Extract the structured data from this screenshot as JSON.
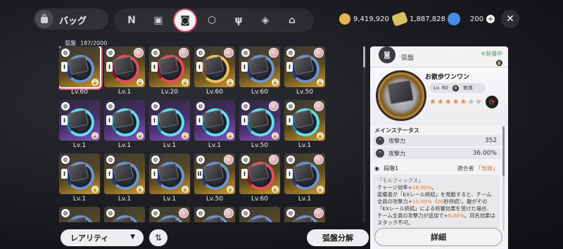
{
  "header": {
    "title": "バッグ",
    "tabs": [
      {
        "icon": "n-mark-icon",
        "glyph": "N"
      },
      {
        "icon": "device-icon",
        "glyph": "▣"
      },
      {
        "icon": "disc-icon",
        "glyph": "◙",
        "active": true
      },
      {
        "icon": "cube-icon",
        "glyph": "⬡"
      },
      {
        "icon": "utensils-icon",
        "glyph": "ψ"
      },
      {
        "icon": "gift-box-icon",
        "glyph": "◈"
      },
      {
        "icon": "home-icon",
        "glyph": "⌂"
      }
    ],
    "currencies": [
      {
        "icon": "coin-icon",
        "color": "#e8b64a",
        "value": "9,419,920"
      },
      {
        "icon": "ticket-icon",
        "color": "#d8c060",
        "value": "1,887,828"
      },
      {
        "icon": "crystal-icon",
        "color": "#4a8ae8",
        "value": "200"
      }
    ],
    "add_glyph": "+",
    "close_glyph": "✕"
  },
  "inventory": {
    "category": "弧盤",
    "count": "187/2000",
    "items": [
      {
        "lv": "Lv.60",
        "color": "gold",
        "disc": "blue",
        "avatar": false,
        "rank": "I",
        "selected": true
      },
      {
        "lv": "Lv.1",
        "color": "gold",
        "disc": "red",
        "avatar": true,
        "rank": "I"
      },
      {
        "lv": "Lv.20",
        "color": "gold",
        "disc": "red",
        "avatar": true,
        "rank": "I"
      },
      {
        "lv": "Lv.60",
        "color": "gold",
        "disc": "gold",
        "avatar": true,
        "rank": "I"
      },
      {
        "lv": "Lv.60",
        "color": "gold",
        "disc": "blue",
        "avatar": true,
        "rank": "I"
      },
      {
        "lv": "Lv.50",
        "color": "gold",
        "disc": "blue",
        "avatar": true,
        "rank": "I"
      },
      {
        "lv": "Lv.1",
        "color": "purple",
        "disc": "cyan",
        "avatar": false,
        "rank": "I"
      },
      {
        "lv": "Lv.1",
        "color": "purple",
        "disc": "cyan",
        "avatar": false,
        "rank": "I"
      },
      {
        "lv": "Lv.1",
        "color": "purple",
        "disc": "cyan",
        "avatar": false,
        "rank": "I"
      },
      {
        "lv": "Lv.1",
        "color": "purple",
        "disc": "cyan",
        "avatar": false,
        "rank": "I"
      },
      {
        "lv": "Lv.50",
        "color": "purple",
        "disc": "cyan",
        "avatar": true,
        "rank": "I"
      },
      {
        "lv": "Lv.1",
        "color": "gold",
        "disc": "cyan",
        "avatar": true,
        "rank": "I"
      },
      {
        "lv": "Lv.1",
        "color": "gold",
        "disc": "blue",
        "avatar": false,
        "rank": "I"
      },
      {
        "lv": "Lv.1",
        "color": "gold",
        "disc": "blue",
        "avatar": false,
        "rank": "I"
      },
      {
        "lv": "Lv.1",
        "color": "gold",
        "disc": "blue",
        "avatar": false,
        "rank": "I"
      },
      {
        "lv": "Lv.50",
        "color": "gold",
        "disc": "blue",
        "avatar": true,
        "rank": "II"
      },
      {
        "lv": "Lv.60",
        "color": "gold",
        "disc": "red",
        "avatar": true,
        "rank": "I"
      },
      {
        "lv": "Lv.1",
        "color": "gold",
        "disc": "blue",
        "avatar": true,
        "rank": "I"
      },
      {
        "lv": "",
        "color": "gold",
        "disc": "blue",
        "avatar": false,
        "rank": "I"
      },
      {
        "lv": "",
        "color": "gold",
        "disc": "blue",
        "avatar": false,
        "rank": "I"
      },
      {
        "lv": "",
        "color": "gold",
        "disc": "blue",
        "avatar": true,
        "rank": "I"
      },
      {
        "lv": "",
        "color": "gold",
        "disc": "blue",
        "avatar": true,
        "rank": "I"
      },
      {
        "lv": "",
        "color": "gold",
        "disc": "blue",
        "avatar": false,
        "rank": "I"
      },
      {
        "lv": "",
        "color": "gold",
        "disc": "blue",
        "avatar": true,
        "rank": "I"
      }
    ]
  },
  "controls": {
    "sort_label": "レアリティ",
    "sort_caret": "▼",
    "order_glyph": "⇅",
    "dismantle_label": "弧盤分解"
  },
  "detail": {
    "category": "弧盤",
    "equipped": "※装備中",
    "name": "お散歩ワンワン",
    "level": "Lv. 60",
    "element": "気体",
    "stars_on": "★★★★★",
    "stars_off": "★★",
    "badge_glyph": "⟳",
    "main_stats_title": "メインステータス",
    "stats": [
      {
        "label": "攻撃力",
        "value": "352"
      },
      {
        "label": "攻撃力",
        "value": "36.00%"
      }
    ],
    "stage": "段階1",
    "fit_label": "適合者",
    "fit_value": "「気体」",
    "desc_name": "「モルフィックス」",
    "desc_lines": [
      [
        "チャージ効率+",
        "18.00%",
        "。"
      ],
      [
        "装備者が「EXレール終結」を発動すると、チーム全員の攻撃力+",
        "10.00%",
        "（",
        "20",
        "秒持続）。敵がその「EXレール終結」による終審効果を受けた場合、チーム全員の攻撃力が追加で+",
        "6.00%",
        "。同名効果はスタック不可。"
      ]
    ],
    "detail_button": "詳細"
  }
}
